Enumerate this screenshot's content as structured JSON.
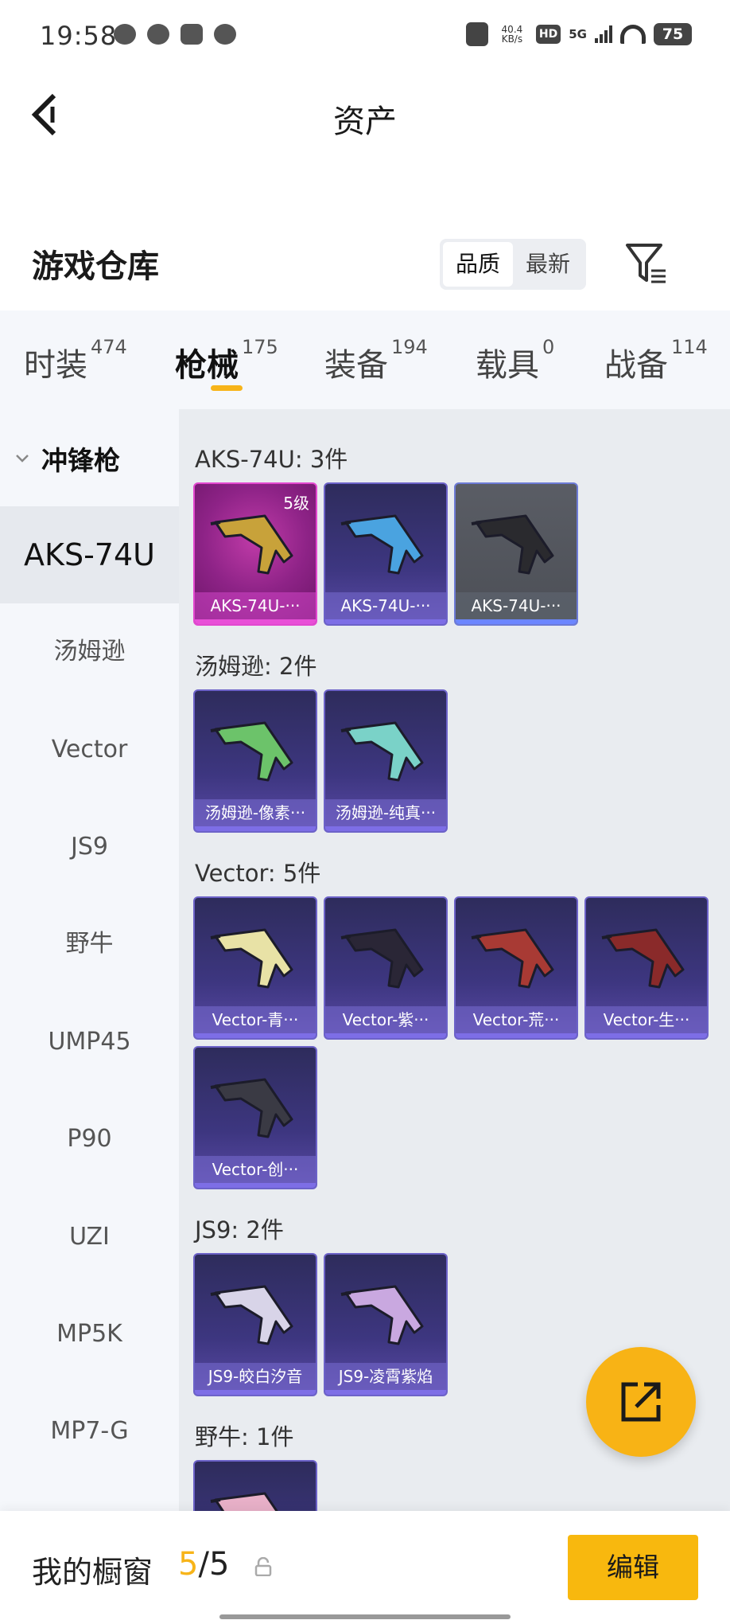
{
  "status_bar": {
    "time": "19:58",
    "net_speed": "40.4",
    "net_unit": "KB/s",
    "hd": "HD",
    "network": "5G",
    "battery": "75"
  },
  "header": {
    "title": "资产"
  },
  "section": {
    "title": "游戏仓库",
    "sort_options": [
      "品质",
      "最新"
    ],
    "active_sort": "品质"
  },
  "tabs": [
    {
      "label": "时装",
      "count": "474"
    },
    {
      "label": "枪械",
      "count": "175",
      "active": true
    },
    {
      "label": "装备",
      "count": "194"
    },
    {
      "label": "载具",
      "count": "0"
    },
    {
      "label": "战备",
      "count": "114"
    }
  ],
  "sidebar": {
    "group": "冲锋枪",
    "items": [
      "AKS-74U",
      "汤姆逊",
      "Vector",
      "JS9",
      "野牛",
      "UMP45",
      "P90",
      "UZI",
      "MP5K",
      "MP7-G"
    ],
    "active": "AKS-74U"
  },
  "groups": [
    {
      "title": "AKS-74U: 3件",
      "cards": [
        {
          "name": "AKS-74U-···",
          "level": "5级",
          "style": "pink"
        },
        {
          "name": "AKS-74U-···",
          "style": "purple"
        },
        {
          "name": "AKS-74U-···",
          "style": "gray"
        }
      ]
    },
    {
      "title": "汤姆逊: 2件",
      "cards": [
        {
          "name": "汤姆逊-像素···",
          "style": "purple"
        },
        {
          "name": "汤姆逊-纯真···",
          "style": "purple"
        }
      ]
    },
    {
      "title": "Vector: 5件",
      "cards": [
        {
          "name": "Vector-青···",
          "style": "purple"
        },
        {
          "name": "Vector-紫···",
          "style": "purple"
        },
        {
          "name": "Vector-荒···",
          "style": "purple"
        },
        {
          "name": "Vector-生···",
          "style": "purple"
        },
        {
          "name": "Vector-创···",
          "style": "purple"
        }
      ]
    },
    {
      "title": "JS9: 2件",
      "cards": [
        {
          "name": "JS9-皎白汐音",
          "style": "purple"
        },
        {
          "name": "JS9-凌霄紫焰",
          "style": "purple"
        }
      ]
    },
    {
      "title": "野牛: 1件",
      "cards": [
        {
          "name": "",
          "style": "purple"
        }
      ]
    }
  ],
  "bottom": {
    "showcase_label": "我的橱窗",
    "current": "5",
    "separator": "/",
    "total": "5",
    "edit_label": "编辑"
  },
  "colors": {
    "accent": "#f8b80e",
    "card_purple": "#3d3680",
    "card_pink": "#8e2387"
  }
}
